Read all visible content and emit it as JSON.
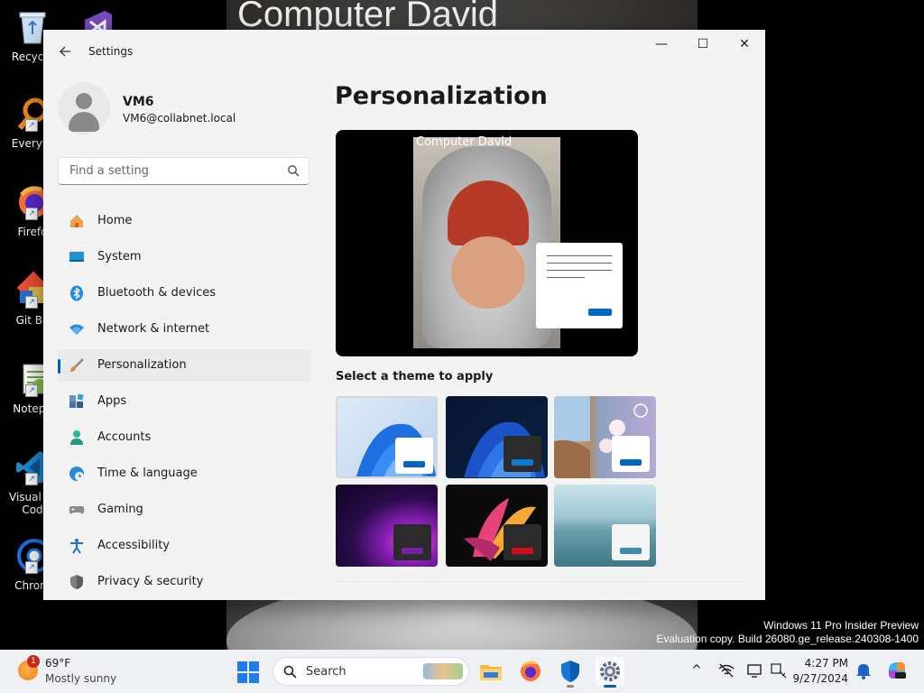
{
  "desktop": {
    "wallpaper_caption": "Computer David",
    "icons": [
      {
        "label": "Recycle"
      },
      {
        "label": "Everyth"
      },
      {
        "label": "Firefo"
      },
      {
        "label": "Git Ba"
      },
      {
        "label": "Notepa"
      },
      {
        "label": "Visual St"
      },
      {
        "label": "Cod"
      },
      {
        "label": "Chrom"
      }
    ],
    "watermark": {
      "line1": "Windows 11 Pro Insider Preview",
      "line2": "Evaluation copy. Build 26080.ge_release.240308-1400"
    }
  },
  "window": {
    "title": "Settings",
    "back_icon": "arrow-left-icon",
    "controls": {
      "minimize": "—",
      "maximize": "☐",
      "close": "✕"
    }
  },
  "user": {
    "name": "VM6",
    "email": "VM6@collabnet.local"
  },
  "search": {
    "placeholder": "Find a setting"
  },
  "nav": {
    "items": [
      {
        "label": "Home",
        "icon": "home-icon"
      },
      {
        "label": "System",
        "icon": "monitor-icon"
      },
      {
        "label": "Bluetooth & devices",
        "icon": "bluetooth-icon"
      },
      {
        "label": "Network & internet",
        "icon": "wifi-icon"
      },
      {
        "label": "Personalization",
        "icon": "paintbrush-icon",
        "selected": true
      },
      {
        "label": "Apps",
        "icon": "apps-icon"
      },
      {
        "label": "Accounts",
        "icon": "person-icon"
      },
      {
        "label": "Time & language",
        "icon": "globe-clock-icon"
      },
      {
        "label": "Gaming",
        "icon": "gamepad-icon"
      },
      {
        "label": "Accessibility",
        "icon": "accessibility-icon"
      },
      {
        "label": "Privacy & security",
        "icon": "shield-icon"
      }
    ]
  },
  "main": {
    "title": "Personalization",
    "preview_caption": "Computer David",
    "theme_label": "Select a theme to apply",
    "themes": [
      {
        "name": "windows-light",
        "accent": "#0067c0",
        "selected": true
      },
      {
        "name": "windows-dark",
        "accent": "#0067c0"
      },
      {
        "name": "spotlight",
        "accent": "#0067c0"
      },
      {
        "name": "glow",
        "accent": "#7a1fa2"
      },
      {
        "name": "captured-motion",
        "accent": "#d10d1a"
      },
      {
        "name": "flow",
        "accent": "#3a8fb0"
      }
    ]
  },
  "taskbar": {
    "weather": {
      "temp": "69°F",
      "desc": "Mostly sunny",
      "badge": "1"
    },
    "search_label": "Search",
    "apps": [
      "file-explorer-icon",
      "firefox-icon",
      "defender-icon",
      "settings-icon"
    ],
    "clock": {
      "time": "4:27 PM",
      "date": "9/27/2024"
    }
  },
  "colors": {
    "accent": "#005fb8",
    "window_bg": "#f3f3f3",
    "taskbar_bg": "#eef0f4"
  }
}
